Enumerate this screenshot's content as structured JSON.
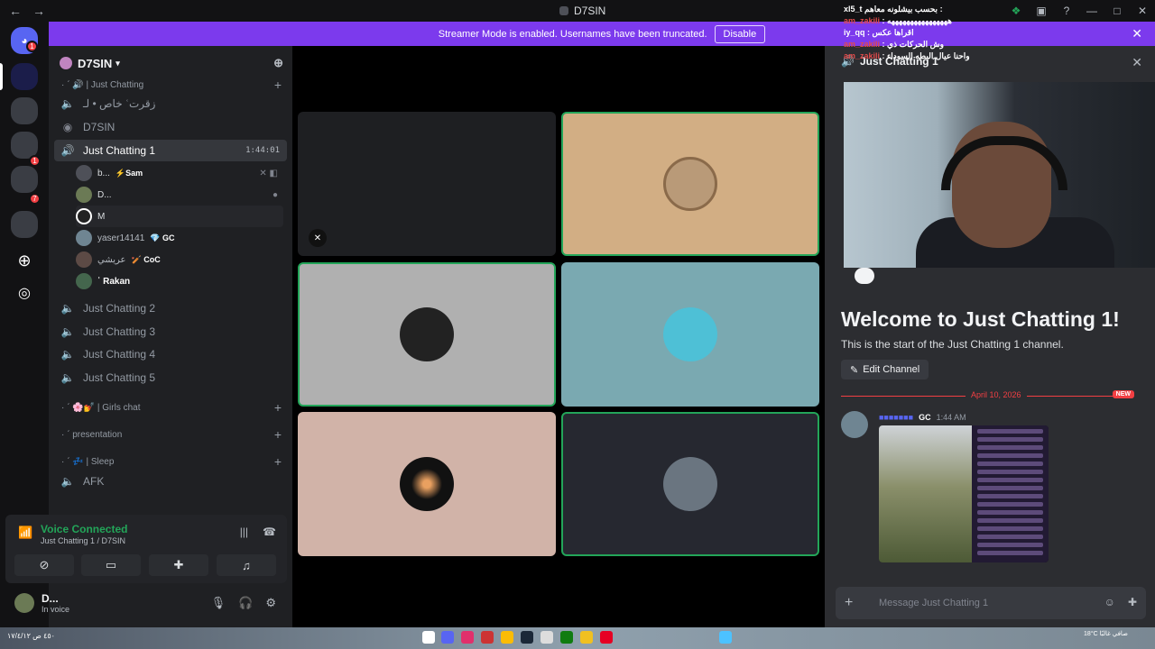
{
  "window": {
    "title": "D7SIN",
    "back": "←",
    "forward": "→"
  },
  "stream_overlay": {
    "lines": [
      {
        "user": "xl5_t",
        "text": "بحسب بيشلونه معاهم :",
        "style": "w"
      },
      {
        "user": "am_zakili",
        "text": ": ههههههههههههههههه",
        "style": "u"
      },
      {
        "user": "iy_qq",
        "text": ": اقراها عكس",
        "style": "w"
      },
      {
        "user": "am_zakili",
        "text": ": وش الحركات ذي",
        "style": "u"
      },
      {
        "user": "am_zakili",
        "text": ": واحنا عيال البطه السوداء",
        "style": "u"
      }
    ]
  },
  "banner": {
    "text": "Streamer Mode is enabled. Usernames have been truncated.",
    "button": "Disable"
  },
  "server": {
    "name": "D7SIN"
  },
  "channels": {
    "cat1": "· ˊ 🔊 | Just Chatting",
    "private": "خاص • لـ ʿزقرت",
    "stage": "D7SIN",
    "active": "Just Chatting 1",
    "timer": "1:44:01",
    "others": [
      "Just Chatting 2",
      "Just Chatting 3",
      "Just Chatting 4",
      "Just Chatting 5"
    ],
    "girls": "· ˊ 🌸💅 | Girls chat",
    "presentation": "· ˊ presentation",
    "sleep": "· ˊ 💤 | Sleep",
    "afk": "AFK"
  },
  "members": [
    {
      "name": "b...",
      "tag": "⚡Sam"
    },
    {
      "name": "D...",
      "tag": ""
    },
    {
      "name": "M",
      "tag": ""
    },
    {
      "name": "yaser14141",
      "tag": "💎 GC"
    },
    {
      "name": "عريشي",
      "tag": "🏏 CoC"
    },
    {
      "name": "ʿ Rakan",
      "tag": ""
    }
  ],
  "voice": {
    "status": "Voice Connected",
    "channel": "Just Chatting 1 / D7SIN"
  },
  "user": {
    "name": "D...",
    "status": "In voice"
  },
  "chat": {
    "header": "Just Chatting 1",
    "welcome": "Welcome to Just Chatting 1!",
    "start": "This is the start of the Just Chatting 1 channel.",
    "edit": "Edit Channel",
    "date": "April 10, 2026",
    "new": "NEW",
    "msg_tag": "GC",
    "msg_time": "1:44 AM",
    "placeholder": "Message Just Chatting 1"
  },
  "taskbar": {
    "left": "٤٥٠ ص\n١٧/٤/١٢",
    "right": "18°C\nصافي غالبًا"
  },
  "colors": {
    "brand": "#5865f2",
    "green": "#23a559",
    "red": "#f23f43",
    "banner": "#7c3aed"
  },
  "icons": [
    "discord-icon",
    "speaker-icon",
    "plus-icon",
    "stage-icon",
    "mute-icon",
    "headphones-icon",
    "gear-icon",
    "pencil-icon",
    "smile-icon"
  ]
}
